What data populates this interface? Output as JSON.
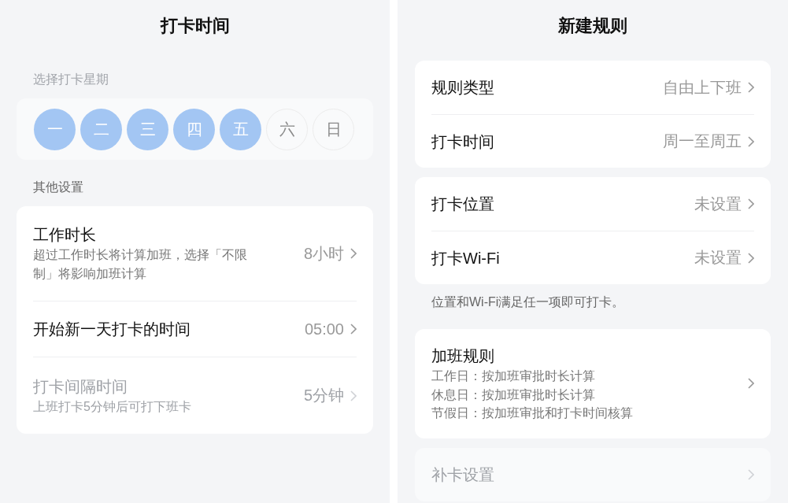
{
  "left_panel": {
    "title": "打卡时间",
    "weekday_label": "选择打卡星期",
    "weekdays": [
      {
        "label": "一",
        "selected": true
      },
      {
        "label": "二",
        "selected": true
      },
      {
        "label": "三",
        "selected": true
      },
      {
        "label": "四",
        "selected": true
      },
      {
        "label": "五",
        "selected": true
      },
      {
        "label": "六",
        "selected": false
      },
      {
        "label": "日",
        "selected": false
      }
    ],
    "settings_label": "其他设置",
    "settings": [
      {
        "title": "工作时长",
        "description": "超过工作时长将计算加班，选择「不限制」将影响加班计算",
        "value": "8小时",
        "disabled": false
      },
      {
        "title": "开始新一天打卡的时间",
        "value": "05:00",
        "disabled": false
      },
      {
        "title": "打卡间隔时间",
        "description": "上班打卡5分钟后可打下班卡",
        "value": "5分钟",
        "disabled": true
      }
    ]
  },
  "right_panel": {
    "title": "新建规则",
    "groups": [
      {
        "rows": [
          {
            "title": "规则类型",
            "value": "自由上下班",
            "disabled": false
          },
          {
            "title": "打卡时间",
            "value": "周一至周五",
            "disabled": false
          }
        ]
      },
      {
        "rows": [
          {
            "title": "打卡位置",
            "value": "未设置",
            "disabled": false
          },
          {
            "title": "打卡Wi-Fi",
            "value": "未设置",
            "disabled": false
          }
        ],
        "note": "位置和Wi-Fi满足任一项即可打卡。"
      },
      {
        "rows": [
          {
            "title": "加班规则",
            "lines": [
              "工作日：按加班审批时长计算",
              "休息日：按加班审批时长计算",
              "节假日：按加班审批和打卡时间核算"
            ],
            "disabled": false
          }
        ]
      },
      {
        "rows": [
          {
            "title": "补卡设置",
            "disabled": true
          }
        ]
      }
    ]
  }
}
